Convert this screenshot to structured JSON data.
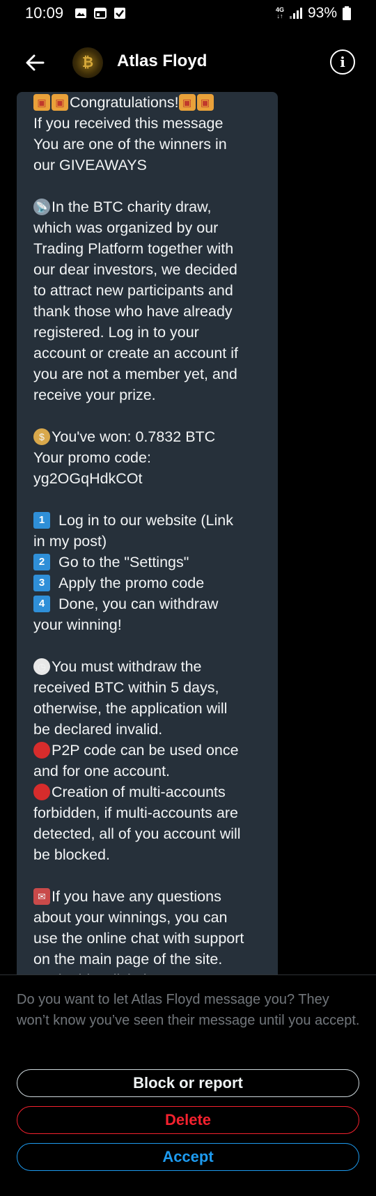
{
  "status_bar": {
    "time": "10:09",
    "network": "4G",
    "battery": "93%"
  },
  "header": {
    "title": "Atlas Floyd",
    "avatar_letter": "₿"
  },
  "message": {
    "lines": [
      {
        "emoji": [
          "gift",
          "gift"
        ],
        "text": "Congratulations!",
        "trail_emoji": [
          "gift",
          "gift"
        ]
      },
      {
        "text": "If you received this message"
      },
      {
        "text": "You are one of the winners in"
      },
      {
        "text": "our GIVEAWAYS"
      },
      {
        "gap": true
      },
      {
        "emoji": [
          "sat"
        ],
        "text": "In the BTC charity draw,"
      },
      {
        "text": "which was organized by our"
      },
      {
        "text": "Trading Platform together with"
      },
      {
        "text": "our dear investors, we decided"
      },
      {
        "text": "to attract new participants and"
      },
      {
        "text": "thank those who have already"
      },
      {
        "text": "registered. Log in to your"
      },
      {
        "text": "account or create an account if"
      },
      {
        "text": "you are not a member yet, and"
      },
      {
        "text": "receive your prize."
      },
      {
        "gap": true
      },
      {
        "emoji": [
          "bag"
        ],
        "text": "You've won: 0.7832 BTC"
      },
      {
        "text": "Your promo code:"
      },
      {
        "text": "yg2OGqHdkCOt"
      },
      {
        "gap": true
      },
      {
        "num": "1",
        "text": "Log in to our website (Link"
      },
      {
        "text": "in my post)"
      },
      {
        "num": "2",
        "text": "Go to the \"Settings\""
      },
      {
        "num": "3",
        "text": "Apply the promo code"
      },
      {
        "num": "4",
        "text": "Done, you can withdraw"
      },
      {
        "text": "your winning!"
      },
      {
        "gap": true
      },
      {
        "emoji": [
          "clock"
        ],
        "text": "You must withdraw the"
      },
      {
        "text": "received BTC within 5 days,"
      },
      {
        "text": "otherwise, the application will"
      },
      {
        "text": "be declared invalid."
      },
      {
        "emoji": [
          "stop"
        ],
        "text": "P2P code can be used once"
      },
      {
        "text": "and for one account."
      },
      {
        "emoji": [
          "stop"
        ],
        "text": "Creation of multi-accounts"
      },
      {
        "text": "forbidden, if multi-accounts are"
      },
      {
        "text": "detected, all of you account will"
      },
      {
        "text": "be blocked."
      },
      {
        "gap": true
      },
      {
        "emoji": [
          "mail"
        ],
        "text": "If you have any questions"
      },
      {
        "text": "about your winnings, you can"
      },
      {
        "text": "use the online chat with support"
      },
      {
        "text": "on the main page of the site."
      },
      {
        "text": "To do this, click the \"Support\""
      }
    ]
  },
  "request": {
    "prompt": "Do you want to let Atlas Floyd message you? They won’t know you’ve seen their message until you accept.",
    "block_label": "Block or report",
    "delete_label": "Delete",
    "accept_label": "Accept"
  },
  "colors": {
    "bubble": "#26303a",
    "accent": "#1d9bf0",
    "danger": "#f4212e"
  }
}
